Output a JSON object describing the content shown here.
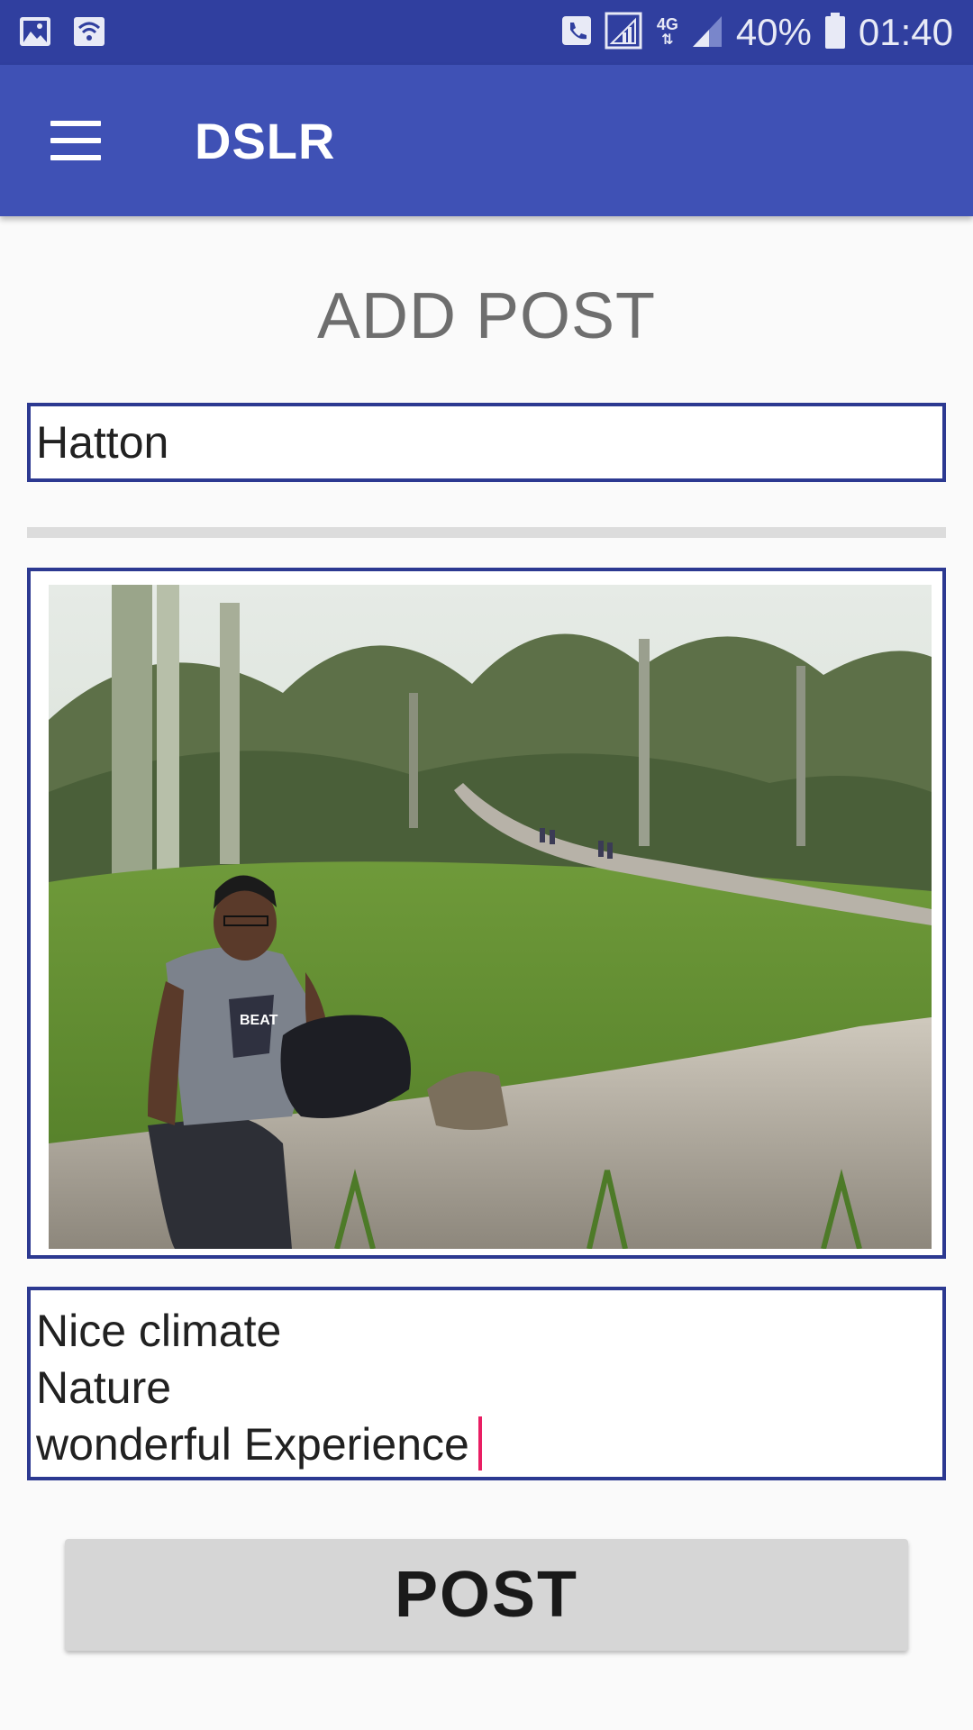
{
  "status_bar": {
    "battery_percent": "40%",
    "time": "01:40",
    "network": "4G"
  },
  "app_bar": {
    "title": "DSLR",
    "menu_icon": "hamburger-menu-icon"
  },
  "page": {
    "heading": "ADD POST",
    "title_field_value": "Hatton",
    "description_lines": [
      "Nice climate",
      "Nature",
      "wonderful Experience"
    ],
    "post_button_label": "POST"
  },
  "colors": {
    "status_bar": "#303f9f",
    "app_bar": "#3f51b5",
    "field_border": "#2c3991",
    "caret": "#e91e63",
    "button_bg": "#d6d6d6"
  }
}
